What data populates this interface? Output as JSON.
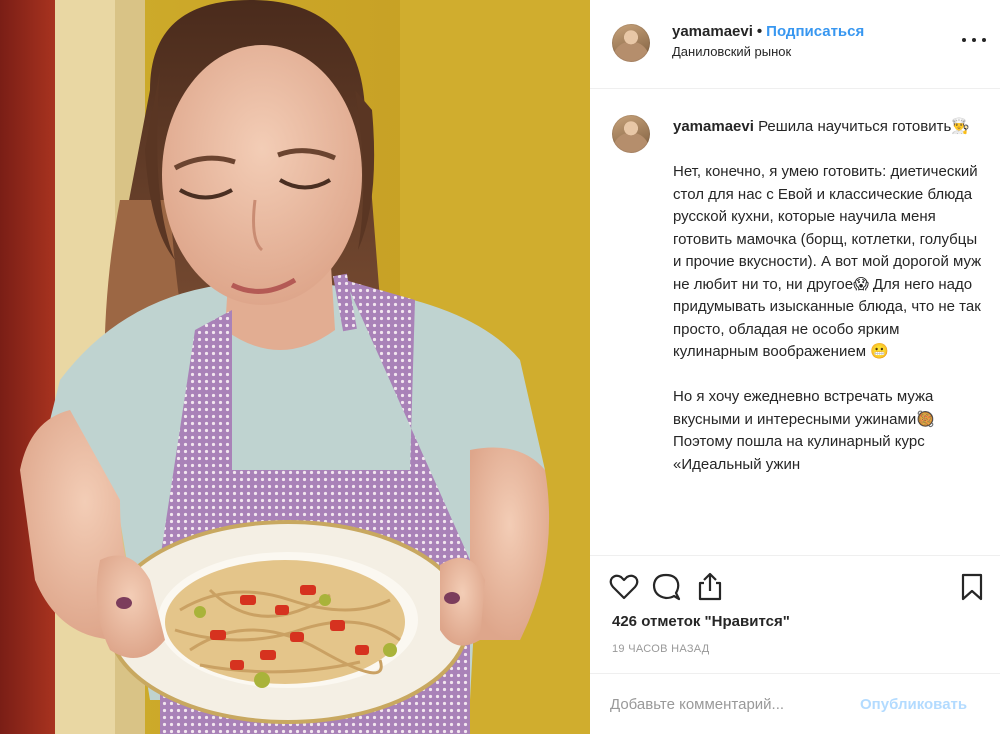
{
  "post": {
    "username": "yamamaevi",
    "separator": "•",
    "follow_label": "Подписаться",
    "location": "Даниловский рынок",
    "caption_text": "Решила научиться готовить👨‍🍳\n\nНет, конечно, я умею готовить: диетический стол для нас с Евой и классические блюда русской кухни, которые научила меня готовить мамочка (борщ, котлетки, голубцы и прочие вкусности). А вот мой дорогой муж не любит ни то, ни другое😱 Для него надо придумывать изысканные блюда, что не так просто, обладая не особо ярким кулинарным воображением 😬\n\nНо я хочу ежедневно встречать мужа вкусными и интересными ужинами🥘 Поэтому пошла на кулинарный курс «Идеальный ужин",
    "likes": "426 отметок \"Нравится\"",
    "timestamp": "19 ЧАСОВ НАЗАД"
  },
  "comment": {
    "placeholder": "Добавьте комментарий...",
    "publish_label": "Опубликовать"
  },
  "icons": {
    "more": "more-options-icon",
    "like": "heart-icon",
    "comment": "comment-icon",
    "share": "share-icon",
    "save": "bookmark-icon"
  },
  "colors": {
    "accent": "#3897f0",
    "publish_disabled": "#b3dbff",
    "muted_text": "#999999",
    "divider": "#efefef",
    "wall_yellow": "#d6b838",
    "apron_pink": "#b98ab8"
  }
}
